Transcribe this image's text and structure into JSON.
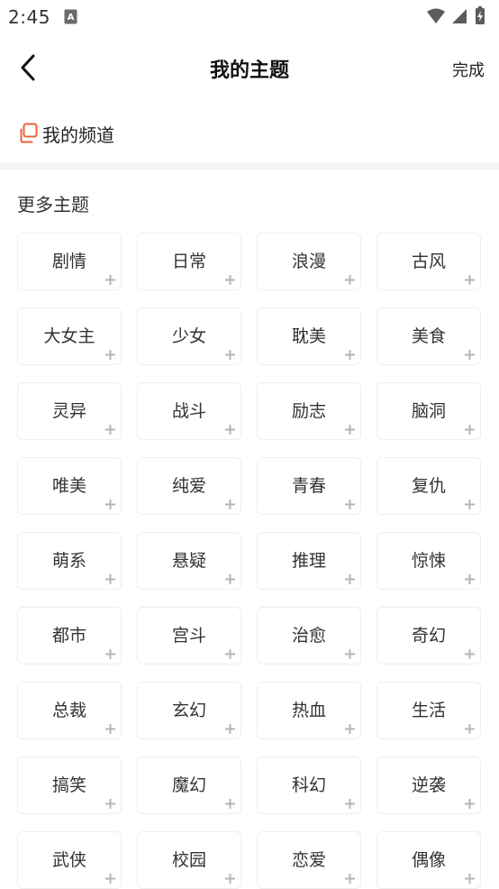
{
  "status_bar": {
    "time": "2:45",
    "notification_icon": "text-notification-icon",
    "right_icons": [
      "wifi-icon",
      "signal-icon",
      "battery-charging-icon"
    ]
  },
  "header": {
    "back_icon": "back-chevron-icon",
    "title": "我的主题",
    "done_label": "完成"
  },
  "my_channel": {
    "icon": "copy-icon",
    "label": "我的频道",
    "accent_color": "#e8623b"
  },
  "more_topics": {
    "title": "更多主题",
    "add_icon": "plus-icon",
    "tags": [
      "剧情",
      "日常",
      "浪漫",
      "古风",
      "大女主",
      "少女",
      "耽美",
      "美食",
      "灵异",
      "战斗",
      "励志",
      "脑洞",
      "唯美",
      "纯爱",
      "青春",
      "复仇",
      "萌系",
      "悬疑",
      "推理",
      "惊悚",
      "都市",
      "宫斗",
      "治愈",
      "奇幻",
      "总裁",
      "玄幻",
      "热血",
      "生活",
      "搞笑",
      "魔幻",
      "科幻",
      "逆袭",
      "武侠",
      "校园",
      "恋爱",
      "偶像"
    ]
  }
}
